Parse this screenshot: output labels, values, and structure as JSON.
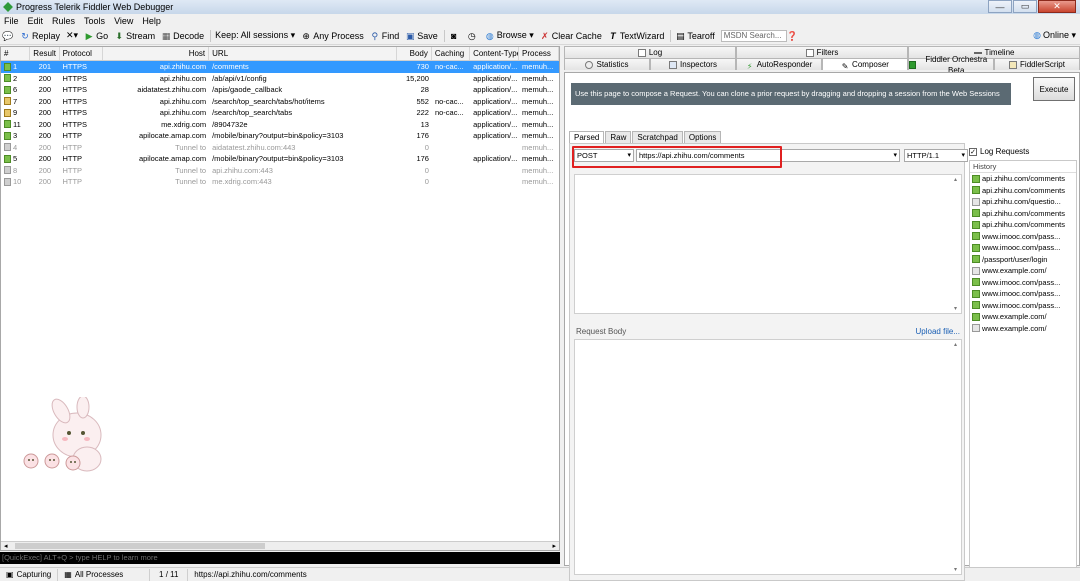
{
  "window": {
    "title": "Progress Telerik Fiddler Web Debugger",
    "min": "—",
    "max": "▭",
    "close": "✕"
  },
  "menu": [
    "File",
    "Edit",
    "Rules",
    "Tools",
    "View",
    "Help"
  ],
  "toolbar": {
    "replay": "Replay",
    "remove": "✕▾",
    "go": "Go",
    "stream": "Stream",
    "decode": "Decode",
    "keep": "Keep: All sessions ▾",
    "process": "Any Process",
    "find": "Find",
    "save": "Save",
    "browse": "Browse ▾",
    "clear_cache": "Clear Cache",
    "textwizard": "TextWizard",
    "tearoff": "Tearoff",
    "search_placeholder": "MSDN Search...",
    "online": "Online ▾"
  },
  "sessions": {
    "headers": [
      "#",
      "Result",
      "Protocol",
      "Host",
      "URL",
      "Body",
      "Caching",
      "Content-Type",
      "Process"
    ],
    "rows": [
      {
        "num": "1",
        "result": "201",
        "protocol": "HTTPS",
        "host": "api.zhihu.com",
        "url": "/comments",
        "body": "730",
        "caching": "no-cac...",
        "ctype": "application/...",
        "process": "memuh...",
        "icon": "green",
        "style": "sel"
      },
      {
        "num": "2",
        "result": "200",
        "protocol": "HTTPS",
        "host": "api.zhihu.com",
        "url": "/ab/api/v1/config",
        "body": "15,200",
        "caching": "",
        "ctype": "application/...",
        "process": "memuh...",
        "icon": "green",
        "style": ""
      },
      {
        "num": "6",
        "result": "200",
        "protocol": "HTTPS",
        "host": "aidatatest.zhihu.com",
        "url": "/apis/gaode_callback",
        "body": "28",
        "caching": "",
        "ctype": "application/...",
        "process": "memuh...",
        "icon": "green",
        "style": ""
      },
      {
        "num": "7",
        "result": "200",
        "protocol": "HTTPS",
        "host": "api.zhihu.com",
        "url": "/search/top_search/tabs/hot/items",
        "body": "552",
        "caching": "no-cac...",
        "ctype": "application/...",
        "process": "memuh...",
        "icon": "img",
        "style": ""
      },
      {
        "num": "9",
        "result": "200",
        "protocol": "HTTPS",
        "host": "api.zhihu.com",
        "url": "/search/top_search/tabs",
        "body": "222",
        "caching": "no-cac...",
        "ctype": "application/...",
        "process": "memuh...",
        "icon": "img",
        "style": ""
      },
      {
        "num": "11",
        "result": "200",
        "protocol": "HTTPS",
        "host": "me.xdrig.com",
        "url": "/8904732e",
        "body": "13",
        "caching": "",
        "ctype": "application/...",
        "process": "memuh...",
        "icon": "green",
        "style": ""
      },
      {
        "num": "3",
        "result": "200",
        "protocol": "HTTP",
        "host": "apilocate.amap.com",
        "url": "/mobile/binary?output=bin&policy=3103",
        "body": "176",
        "caching": "",
        "ctype": "application/...",
        "process": "memuh...",
        "icon": "green",
        "style": ""
      },
      {
        "num": "4",
        "result": "200",
        "protocol": "HTTP",
        "host": "Tunnel to",
        "url": "aidatatest.zhihu.com:443",
        "body": "0",
        "caching": "",
        "ctype": "",
        "process": "memuh...",
        "icon": "grey",
        "style": "tunnel"
      },
      {
        "num": "5",
        "result": "200",
        "protocol": "HTTP",
        "host": "apilocate.amap.com",
        "url": "/mobile/binary?output=bin&policy=3103",
        "body": "176",
        "caching": "",
        "ctype": "application/...",
        "process": "memuh...",
        "icon": "green",
        "style": ""
      },
      {
        "num": "8",
        "result": "200",
        "protocol": "HTTP",
        "host": "Tunnel to",
        "url": "api.zhihu.com:443",
        "body": "0",
        "caching": "",
        "ctype": "",
        "process": "memuh...",
        "icon": "grey",
        "style": "tunnel"
      },
      {
        "num": "10",
        "result": "200",
        "protocol": "HTTP",
        "host": "Tunnel to",
        "url": "me.xdrig.com:443",
        "body": "0",
        "caching": "",
        "ctype": "",
        "process": "memuh...",
        "icon": "grey",
        "style": "tunnel"
      }
    ]
  },
  "quickexec": "[QuickExec] ALT+Q > type HELP to learn more",
  "status": {
    "capturing": "Capturing",
    "processes": "All Processes",
    "count": "1 / 11",
    "url": "https://api.zhihu.com/comments"
  },
  "tabs_row1": [
    "Log",
    "Filters",
    "Timeline"
  ],
  "tabs_row2": [
    "Statistics",
    "Inspectors",
    "AutoResponder",
    "Composer",
    "Fiddler Orchestra Beta",
    "FiddlerScript"
  ],
  "composer": {
    "description": "Use this page to compose a Request. You can clone a prior request by dragging and dropping a session from the Web Sessions list.",
    "execute": "Execute",
    "subtabs": [
      "Parsed",
      "Raw",
      "Scratchpad",
      "Options"
    ],
    "method": "POST",
    "url": "https://api.zhihu.com/comments",
    "version": "HTTP/1.1",
    "request_body_label": "Request Body",
    "upload": "Upload file...",
    "log_requests": "Log Requests",
    "history_label": "History",
    "history": [
      {
        "text": "api.zhihu.com/comments",
        "icon": "green"
      },
      {
        "text": "api.zhihu.com/comments",
        "icon": "green"
      },
      {
        "text": "api.zhihu.com/questio...",
        "icon": "plain"
      },
      {
        "text": "api.zhihu.com/comments",
        "icon": "green"
      },
      {
        "text": "api.zhihu.com/comments",
        "icon": "green"
      },
      {
        "text": "www.imooc.com/pass...",
        "icon": "green"
      },
      {
        "text": "www.imooc.com/pass...",
        "icon": "green"
      },
      {
        "text": "/passport/user/login",
        "icon": "green"
      },
      {
        "text": "www.example.com/",
        "icon": "plain"
      },
      {
        "text": "www.imooc.com/pass...",
        "icon": "green"
      },
      {
        "text": "www.imooc.com/pass...",
        "icon": "green"
      },
      {
        "text": "www.imooc.com/pass...",
        "icon": "green"
      },
      {
        "text": "www.example.com/",
        "icon": "green"
      },
      {
        "text": "www.example.com/",
        "icon": "plain"
      }
    ]
  }
}
